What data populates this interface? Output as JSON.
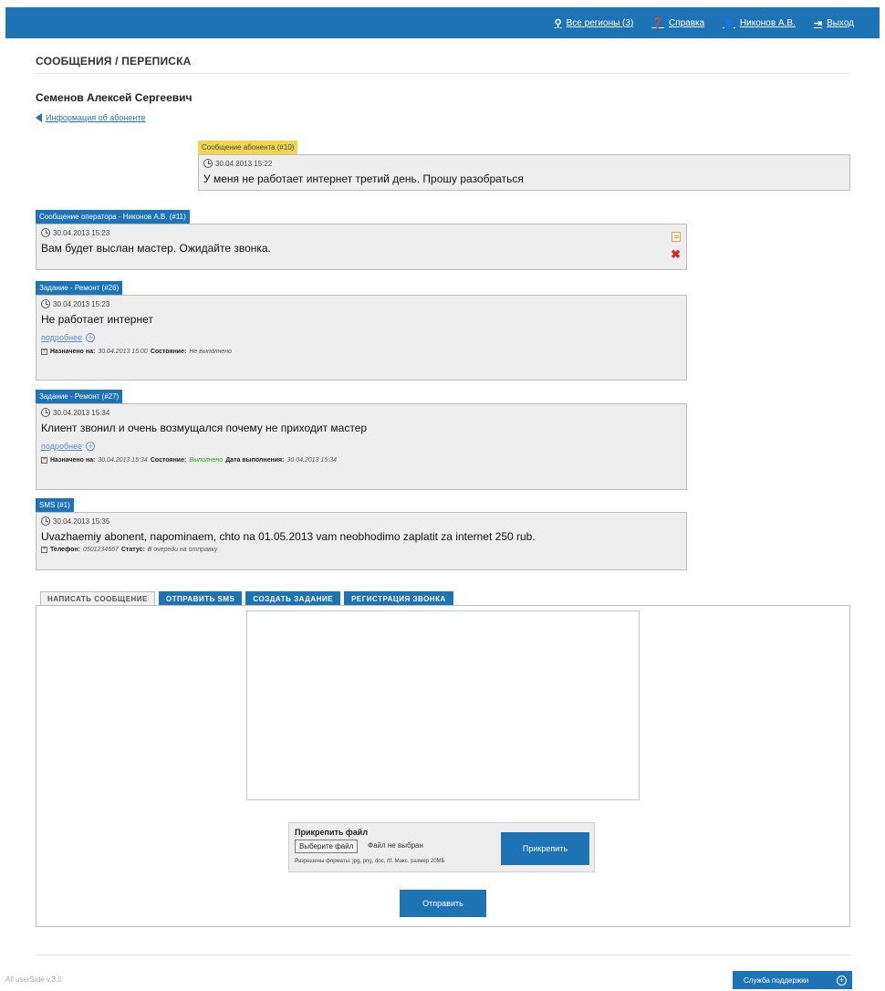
{
  "topnav": {
    "regions": "Все регионы (3)",
    "help": "Справка",
    "user": "Никонов А.В.",
    "logout": "Выход"
  },
  "page": {
    "title": "СООБЩЕНИЯ / ПЕРЕПИСКА",
    "client_name": "Семенов Алексей Сергеевич",
    "client_info_link": "Информация об абоненте"
  },
  "messages": [
    {
      "tag": "Сообщение абонента (#10)",
      "time": "30.04.2013 15:22",
      "text": "У меня не работает интернет третий день. Прошу разобраться"
    },
    {
      "tag": "Сообщение оператора - Никонов А.В. (#11)",
      "time": "30.04.2013 15:23",
      "text": "Вам будет выслан мастер. Ожидайте звонка."
    },
    {
      "tag": "Задание - Ремонт (#26)",
      "time": "30.04.2013 15:23",
      "text": "Не работает интернет",
      "more": "подробнее",
      "foot_label1": "Назначено на:",
      "foot_value1": "30.04.2013 15:00",
      "foot_label2": "Состояние:",
      "foot_value2": "Не выполнено"
    },
    {
      "tag": "Задание - Ремонт (#27)",
      "time": "30.04.2013 15:34",
      "text": "Клиент звонил и очень возмущался почему не приходит мастер",
      "more": "подробнее",
      "foot_label1": "Назначено на:",
      "foot_value1": "30.04.2013 15:34",
      "foot_label2": "Состояние:",
      "foot_value2": "Выполнено",
      "foot_label3": "Дата выполнения:",
      "foot_value3": "30.04.2013 15:34"
    },
    {
      "tag": "SMS (#1)",
      "time": "30.04.2013 15:35",
      "text": "Uvazhaemiy abonent, napominaem, chto na 01.05.2013 vam neobhodimo zaplatit za internet 250 rub.",
      "foot_label1": "Телефон:",
      "foot_value1": "0501234567",
      "foot_label2": "Статус:",
      "foot_value2": "В очереди на отправку"
    }
  ],
  "tabs": [
    "НАПИСАТЬ СООБЩЕНИЕ",
    "ОТПРАВИТЬ SMS",
    "СОЗДАТЬ ЗАДАНИЕ",
    "РЕГИСТРАЦИЯ ЗВОНКА"
  ],
  "form": {
    "message_value": "",
    "attach_title": "Прикрепить файл",
    "choose_file": "Выберите файл",
    "no_file": "Файл не выбран",
    "hint": "Разрешены форматы: jpg, png, doc, rtf. Макс. размер 20МБ",
    "attach_button": "Прикрепить",
    "send_button": "Отправить"
  },
  "footer": {
    "version": "All userSide v.3.0",
    "support": "Служба поддержки"
  },
  "colors": {
    "brand": "#1e73b5",
    "client_tag": "#f3d54e",
    "status_done": "#1fa51f",
    "delete": "#d52b2b"
  }
}
